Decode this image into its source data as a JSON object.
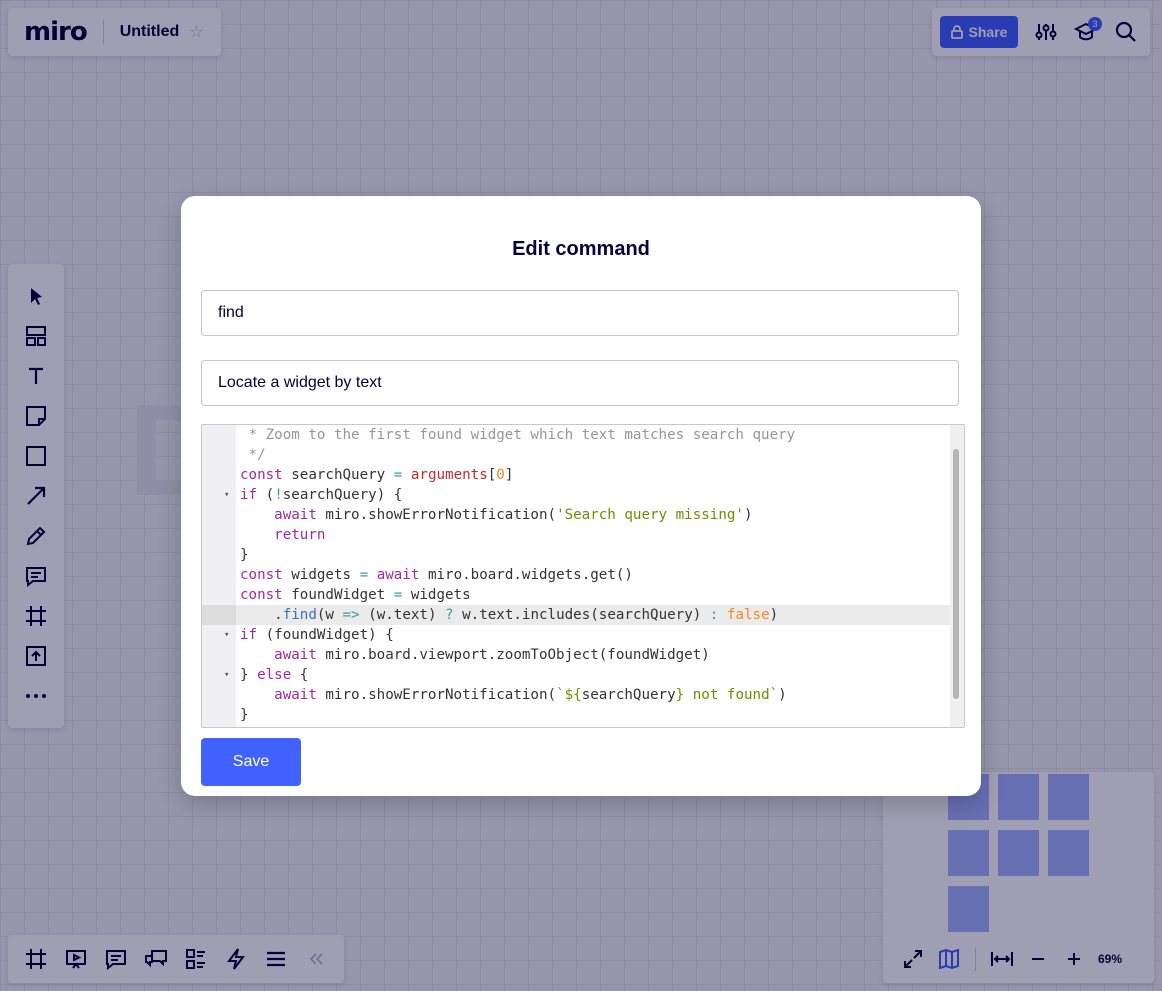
{
  "app": {
    "logo": "miro",
    "board_title": "Untitled"
  },
  "topbar": {
    "share_label": "Share",
    "notifications_count": "3"
  },
  "left_toolbar": {
    "icons": [
      "cursor-icon",
      "templates-icon",
      "text-icon",
      "sticky-note-icon",
      "shape-icon",
      "arrow-icon",
      "pen-icon",
      "comment-icon",
      "frame-icon",
      "upload-icon",
      "more-icon"
    ]
  },
  "bottom_toolbar": {
    "icons": [
      "frames-icon",
      "presentation-icon",
      "comments-icon",
      "cards-icon",
      "kanban-icon",
      "lightning-icon",
      "list-icon",
      "collapse-icon"
    ]
  },
  "zoom": {
    "level": "69%"
  },
  "modal": {
    "title": "Edit command",
    "name_value": "find",
    "description_value": "Locate a widget by text",
    "save_label": "Save",
    "code": [
      [
        {
          "t": " * Zoom to the first found widget which text matches search query",
          "c": "cm"
        }
      ],
      [
        {
          "t": " */",
          "c": "cm"
        }
      ],
      [
        {
          "t": "const",
          "c": "kw"
        },
        {
          "t": " searchQuery "
        },
        {
          "t": "=",
          "c": "op"
        },
        {
          "t": " "
        },
        {
          "t": "arguments",
          "c": "var"
        },
        {
          "t": "["
        },
        {
          "t": "0",
          "c": "num"
        },
        {
          "t": "]"
        }
      ],
      [
        {
          "t": "if",
          "c": "kw"
        },
        {
          "t": " ("
        },
        {
          "t": "!",
          "c": "op"
        },
        {
          "t": "searchQuery) {"
        }
      ],
      [
        {
          "t": "    "
        },
        {
          "t": "await",
          "c": "kw"
        },
        {
          "t": " miro.showErrorNotification("
        },
        {
          "t": "'Search query missing'",
          "c": "str"
        },
        {
          "t": ")"
        }
      ],
      [
        {
          "t": "    "
        },
        {
          "t": "return",
          "c": "kw"
        }
      ],
      [
        {
          "t": "}"
        }
      ],
      [
        {
          "t": "const",
          "c": "kw"
        },
        {
          "t": " widgets "
        },
        {
          "t": "=",
          "c": "op"
        },
        {
          "t": " "
        },
        {
          "t": "await",
          "c": "kw"
        },
        {
          "t": " miro.board.widgets.get()"
        }
      ],
      [
        {
          "t": "const",
          "c": "kw"
        },
        {
          "t": " foundWidget "
        },
        {
          "t": "=",
          "c": "op"
        },
        {
          "t": " widgets"
        }
      ],
      [
        {
          "t": "    ."
        },
        {
          "t": "find",
          "c": "fn"
        },
        {
          "t": "(w "
        },
        {
          "t": "=>",
          "c": "op"
        },
        {
          "t": " (w.text) "
        },
        {
          "t": "?",
          "c": "op"
        },
        {
          "t": " w.text.includes(searchQuery) "
        },
        {
          "t": ":",
          "c": "op"
        },
        {
          "t": " "
        },
        {
          "t": "false",
          "c": "bool"
        },
        {
          "t": ")"
        }
      ],
      [
        {
          "t": "if",
          "c": "kw"
        },
        {
          "t": " (foundWidget) {"
        }
      ],
      [
        {
          "t": "    "
        },
        {
          "t": "await",
          "c": "kw"
        },
        {
          "t": " miro.board.viewport.zoomToObject(foundWidget)"
        }
      ],
      [
        {
          "t": "} "
        },
        {
          "t": "else",
          "c": "kw"
        },
        {
          "t": " {"
        }
      ],
      [
        {
          "t": "    "
        },
        {
          "t": "await",
          "c": "kw"
        },
        {
          "t": " miro.showErrorNotification("
        },
        {
          "t": "`${",
          "c": "str"
        },
        {
          "t": "searchQuery"
        },
        {
          "t": "} not found`",
          "c": "str"
        },
        {
          "t": ")"
        }
      ],
      [
        {
          "t": "}"
        }
      ]
    ],
    "folds": [
      3,
      10,
      12
    ],
    "active_line": 9
  },
  "colors": {
    "accent": "#4262ff",
    "text": "#050038",
    "minimap_cell": "#a3b3ff"
  }
}
